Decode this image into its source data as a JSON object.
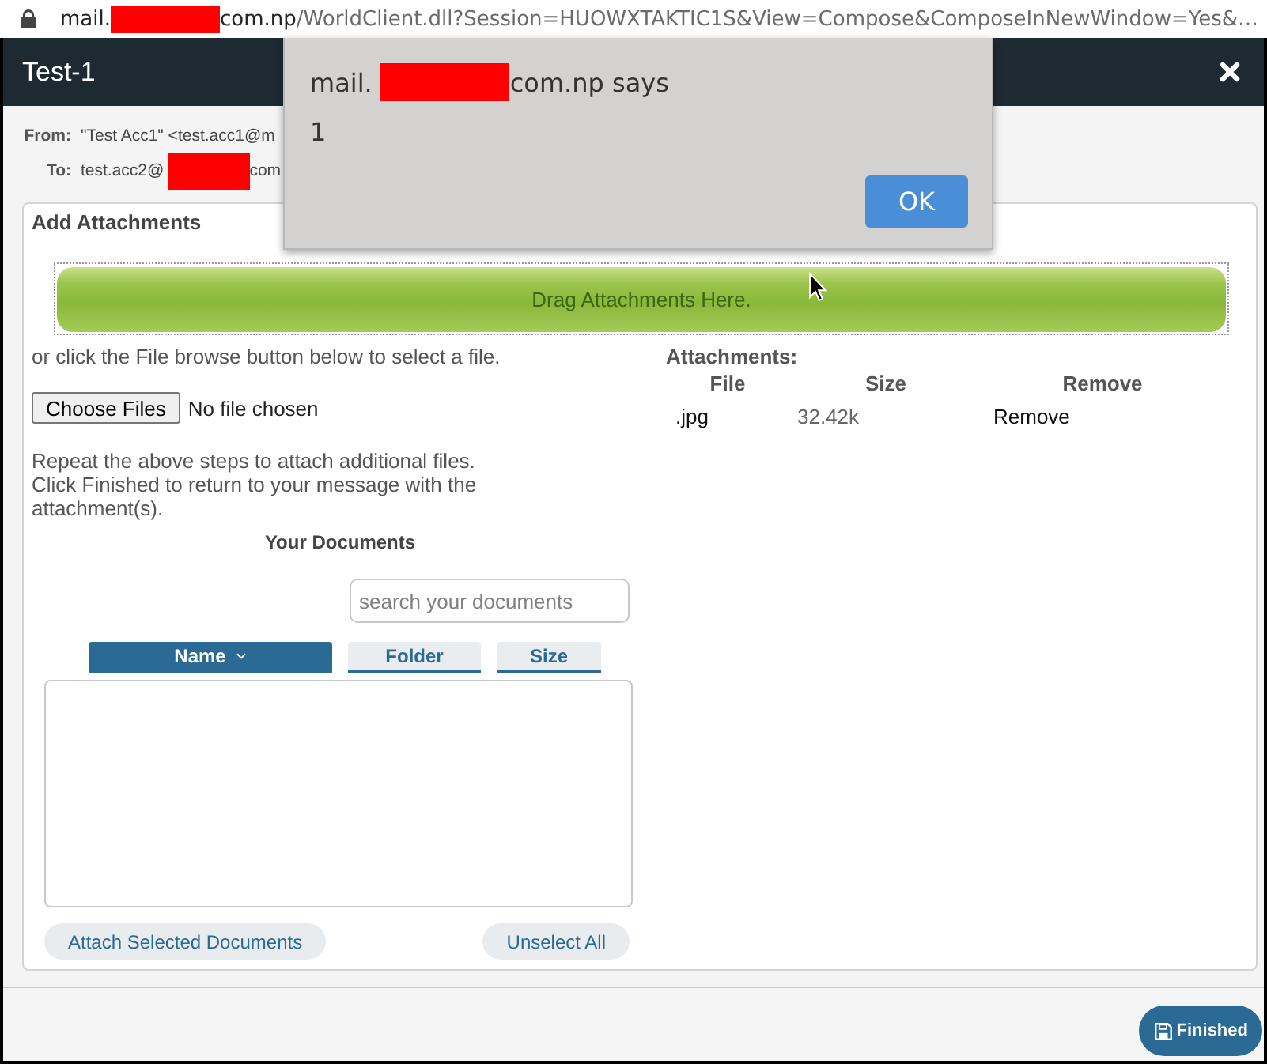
{
  "address_bar": {
    "host_parts": [
      "mail.",
      "com.np"
    ],
    "path": "/WorldClient.dll?Session=HUOWXTAKTIC1S&View=Compose&ComposeInNewWindow=Yes&…"
  },
  "window": {
    "title": "Test-1"
  },
  "header": {
    "fields": [
      {
        "label": "From:",
        "parts": [
          "\"Test Acc1\" <test.acc1@m"
        ]
      },
      {
        "label": "To:",
        "parts": [
          "test.acc2@",
          "com"
        ]
      }
    ]
  },
  "panel": {
    "title": "Add Attachments",
    "drop_zone": "Drag Attachments Here."
  },
  "upload": {
    "instruction": "or click the File browse button below to select a file.",
    "button": "Choose Files",
    "status": "No file chosen",
    "note": "Repeat the above steps to attach additional files. Click Finished to return to your message with the attachment(s)."
  },
  "documents": {
    "title": "Your Documents",
    "search": {
      "placeholder": "search your documents"
    },
    "columns": [
      {
        "label": "Name",
        "selected": true
      },
      {
        "label": "Folder",
        "selected": false
      },
      {
        "label": "Size",
        "selected": false
      }
    ],
    "buttons": [
      "Attach Selected Documents",
      "Unselect All"
    ]
  },
  "attachments": {
    "title": "Attachments:",
    "columns": [
      "File",
      "Size",
      "Remove"
    ],
    "rows": [
      {
        "file": ".jpg",
        "size": "32.42k",
        "action": "Remove"
      }
    ]
  },
  "footer": {
    "button": "Finished"
  },
  "dialog": {
    "title_parts": [
      "mail.",
      "com.np says"
    ],
    "message": "1",
    "button": "OK"
  }
}
